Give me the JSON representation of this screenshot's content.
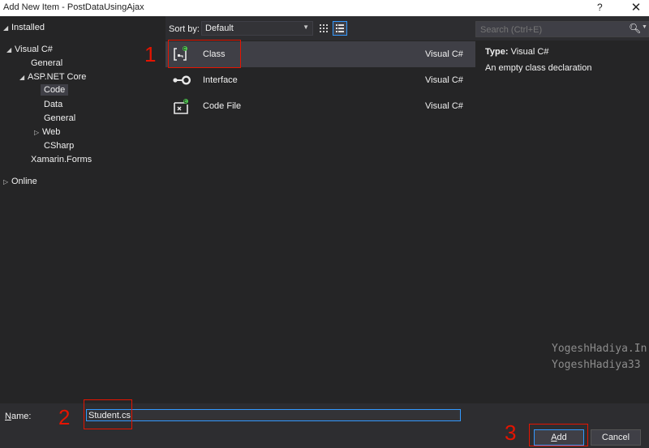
{
  "window": {
    "title": "Add New Item - PostDataUsingAjax",
    "help_label": "?",
    "close_label": "✕"
  },
  "tree": {
    "items": [
      {
        "label": "Installed",
        "arrow": "◢"
      },
      {
        "label": "Visual C#",
        "arrow": "◢"
      },
      {
        "label": "General",
        "arrow": ""
      },
      {
        "label": "ASP.NET Core",
        "arrow": "◢"
      },
      {
        "label": "Code",
        "arrow": "",
        "selected": true
      },
      {
        "label": "Data",
        "arrow": ""
      },
      {
        "label": "General",
        "arrow": ""
      },
      {
        "label": "Web",
        "arrow": "▷"
      },
      {
        "label": "CSharp",
        "arrow": ""
      },
      {
        "label": "Xamarin.Forms",
        "arrow": ""
      },
      {
        "label": "Online",
        "arrow": "▷"
      }
    ]
  },
  "sort": {
    "label": "Sort by:",
    "value": "Default"
  },
  "templates": [
    {
      "name": "Class",
      "language": "Visual C#",
      "icon": "class-icon",
      "selected": true
    },
    {
      "name": "Interface",
      "language": "Visual C#",
      "icon": "interface-icon"
    },
    {
      "name": "Code File",
      "language": "Visual C#",
      "icon": "code-file-icon"
    }
  ],
  "search": {
    "placeholder": "Search (Ctrl+E)"
  },
  "details": {
    "type_label": "Type:",
    "type_value": "Visual C#",
    "description": "An empty class declaration"
  },
  "watermark": {
    "line1": "YogeshHadiya.In",
    "line2": "YogeshHadiya33"
  },
  "name_field": {
    "label_first": "N",
    "label_rest": "ame:",
    "value": "Student.cs"
  },
  "buttons": {
    "add_first": "A",
    "add_rest": "dd",
    "cancel": "Cancel"
  },
  "annotations": {
    "one": "1",
    "two": "2",
    "three": "3"
  },
  "colors": {
    "accent": "#3399ff",
    "annotation": "#e51400",
    "background": "#2d2d30",
    "panel": "#252526"
  }
}
